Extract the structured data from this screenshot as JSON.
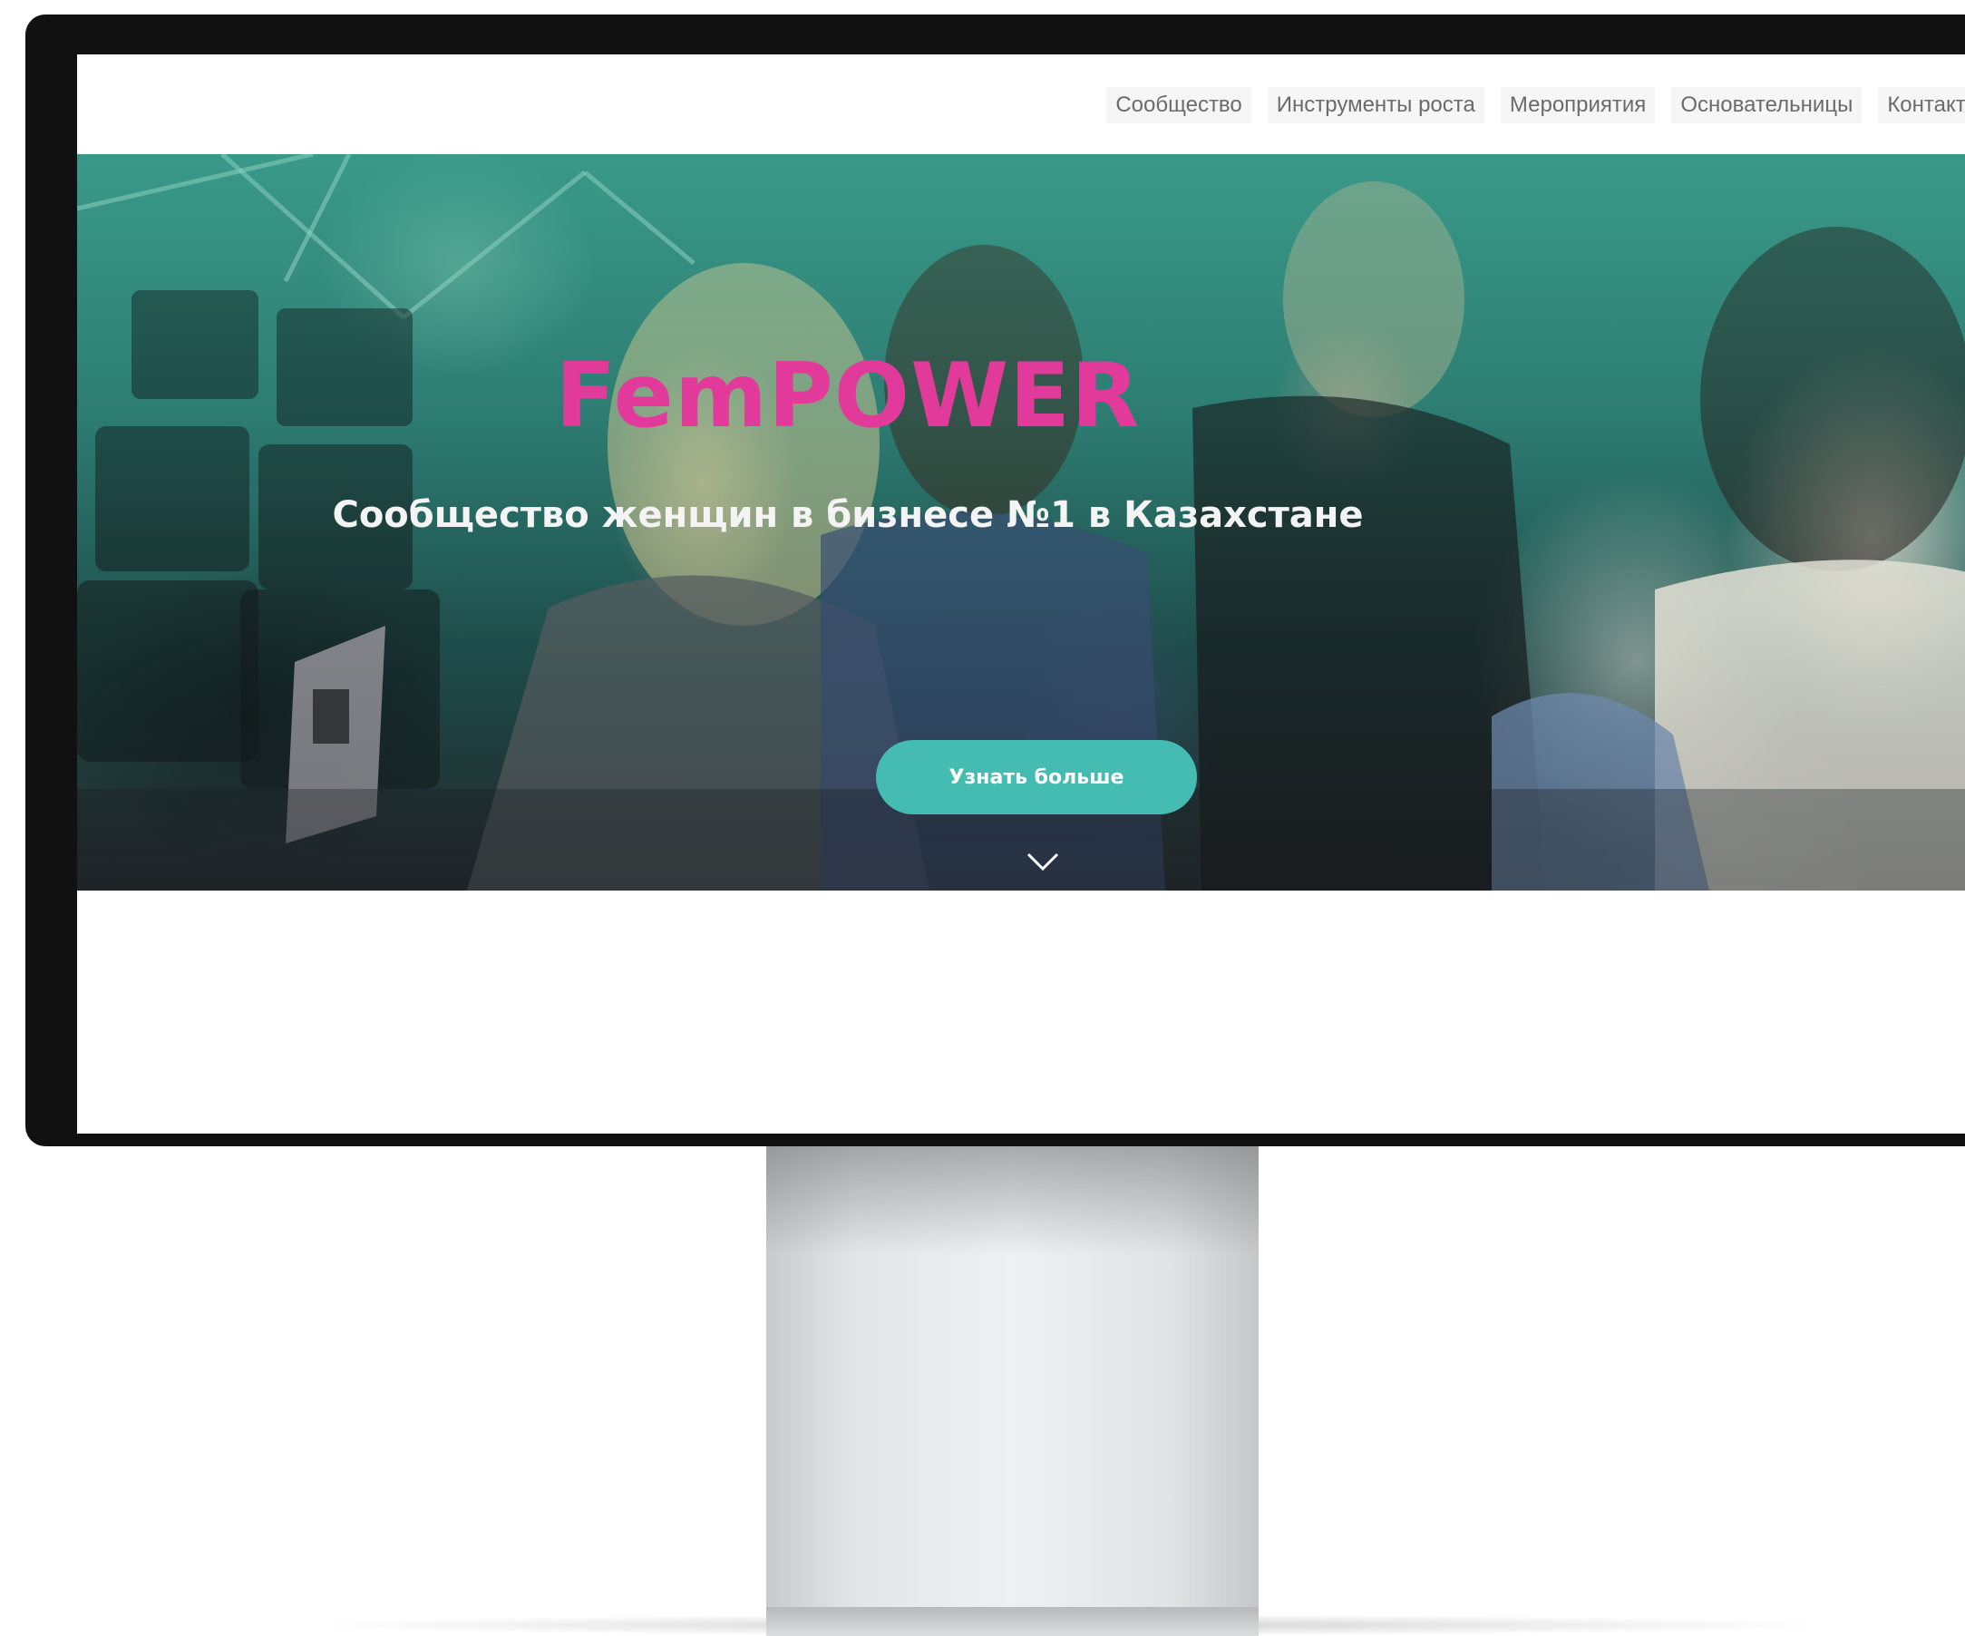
{
  "nav": {
    "items": [
      {
        "label": "Сообщество"
      },
      {
        "label": "Инструменты роста"
      },
      {
        "label": "Мероприятия"
      },
      {
        "label": "Основательницы"
      },
      {
        "label": "Контакты"
      }
    ]
  },
  "hero": {
    "title": "FemPOWER",
    "subtitle": "Сообщество женщин в бизнесе №1 в Казахстане",
    "cta_label": "Узнать больше",
    "scroll_icon": "chevron-down-icon"
  },
  "colors": {
    "title": "#e23a9b",
    "button": "#45bcb2",
    "bezel": "#111111"
  }
}
